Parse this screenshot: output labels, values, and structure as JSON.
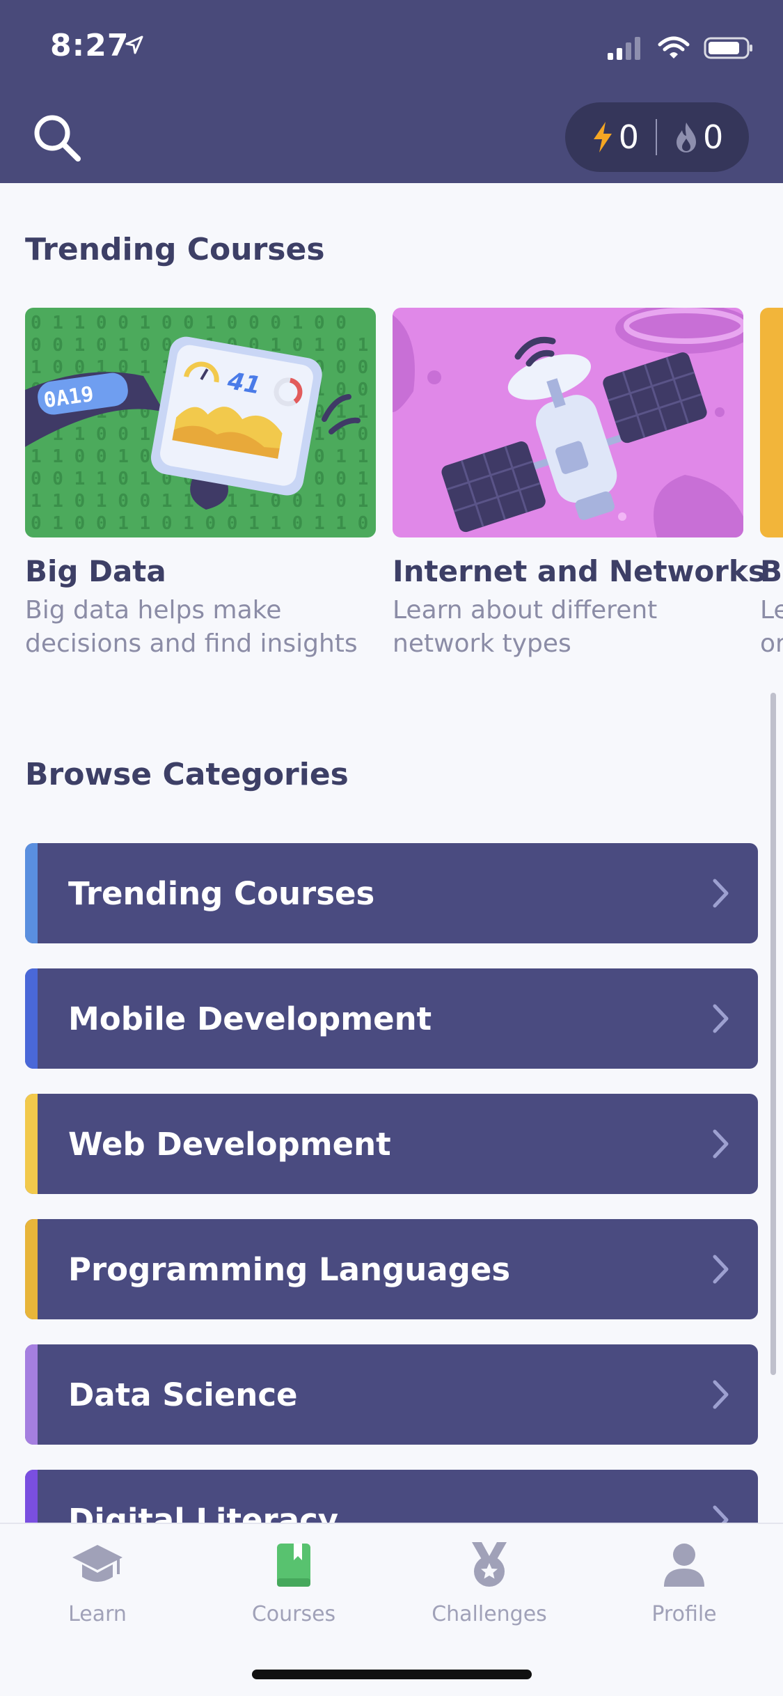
{
  "status_bar": {
    "time": "8:27"
  },
  "header": {
    "stats": {
      "energy_count": "0",
      "streak_count": "0"
    }
  },
  "trending": {
    "title": "Trending Courses",
    "courses": [
      {
        "title": "Big Data",
        "desc_line1": "Big data helps make",
        "desc_line2": "decisions and find insights"
      },
      {
        "title": "Internet and Networks",
        "desc_line1": "Learn about different",
        "desc_line2": "network types"
      },
      {
        "title": "Br",
        "desc_line1": "Le",
        "desc_line2": "or"
      }
    ]
  },
  "browse": {
    "title": "Browse Categories",
    "categories": [
      {
        "label": "Trending Courses",
        "accent": "#5a8fdf"
      },
      {
        "label": "Mobile Development",
        "accent": "#4a68d8"
      },
      {
        "label": "Web Development",
        "accent": "#f2c94c"
      },
      {
        "label": "Programming Languages",
        "accent": "#e8b53a"
      },
      {
        "label": "Data Science",
        "accent": "#a57fe0"
      },
      {
        "label": "Digital Literacy",
        "accent": "#7a4fe0"
      }
    ]
  },
  "bottom_nav": {
    "items": [
      {
        "label": "Learn",
        "icon": "graduation-cap-icon"
      },
      {
        "label": "Courses",
        "icon": "book-icon",
        "active": true
      },
      {
        "label": "Challenges",
        "icon": "medal-icon"
      },
      {
        "label": "Profile",
        "icon": "person-icon"
      }
    ]
  },
  "colors": {
    "header_bg": "#494a7a",
    "category_bg": "#4a4b80",
    "active_nav": "#58c26f"
  }
}
